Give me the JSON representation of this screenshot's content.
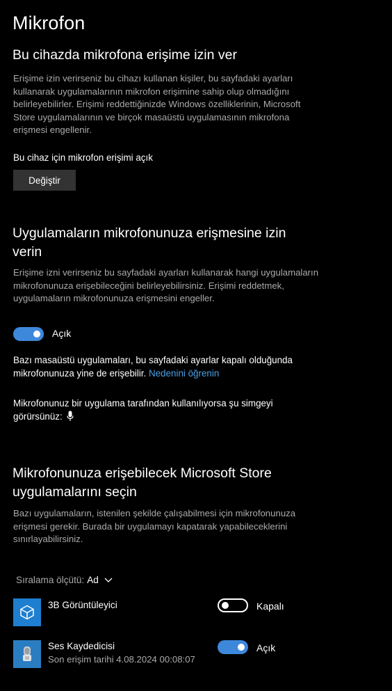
{
  "page": {
    "title": "Mikrofon"
  },
  "device_access": {
    "title": "Bu cihazda mikrofona erişime izin ver",
    "description": "Erişime izin verirseniz bu cihazı kullanan kişiler, bu sayfadaki ayarları kullanarak uygulamalarının mikrofon erişimine sahip olup olmadığını belirleyebilirler. Erişimi reddettiğinizde Windows özelliklerinin, Microsoft Store uygulamalarının ve birçok masaüstü uygulamasının mikrofona erişmesi engellenir.",
    "status": "Bu cihaz için mikrofon erişimi açık",
    "change_button": "Değiştir"
  },
  "app_access": {
    "title": "Uygulamaların mikrofonunuza erişmesine izin verin",
    "description": "Erişime izni verirseniz bu sayfadaki ayarları kullanarak hangi uygulamaların mikrofonunuza erişebileceğini belirleyebilirsiniz. Erişimi reddetmek, uygulamaların mikrofonunuza erişmesini engeller.",
    "toggle_state": "on",
    "toggle_label": "Açık",
    "desktop_note": "Bazı masaüstü uygulamaları, bu sayfadaki ayarlar kapalı olduğunda mikrofonunuza yine de erişebilir.",
    "learn_why_link": "Nedenini öğrenin",
    "icon_note": "Mikrofonunuz bir uygulama tarafından kullanılıyorsa şu simgeyi görürsünüz:",
    "icon_note_icon": "microphone-icon"
  },
  "store_apps": {
    "title": "Mikrofonunuza erişebilecek Microsoft Store uygulamalarını seçin",
    "description": "Bazı uygulamaların, istenilen şekilde çalışabilmesi için mikrofonunuza erişmesi gerekir. Burada bir uygulamayı kapatarak yapabileceklerini sınırlayabilirsiniz.",
    "sort_label": "Sıralama ölçütü:",
    "sort_value": "Ad",
    "apps": [
      {
        "name": "3B Görüntüleyici",
        "subtitle": "",
        "icon": "cube-icon",
        "icon_bg": "#1e7fd0",
        "toggle_state": "off",
        "toggle_label": "Kapalı"
      },
      {
        "name": "Ses Kaydedicisi",
        "subtitle": "Son erişim tarihi 4.08.2024 00:08:07",
        "icon": "voice-recorder-icon",
        "icon_bg": "#2b7dc2",
        "toggle_state": "on",
        "toggle_label": "Açık"
      }
    ]
  },
  "colors": {
    "background": "#000000",
    "accent": "#3e88dc",
    "link": "#4ca0e6",
    "secondary_text": "#aaaaaa",
    "button_bg": "#333333"
  }
}
